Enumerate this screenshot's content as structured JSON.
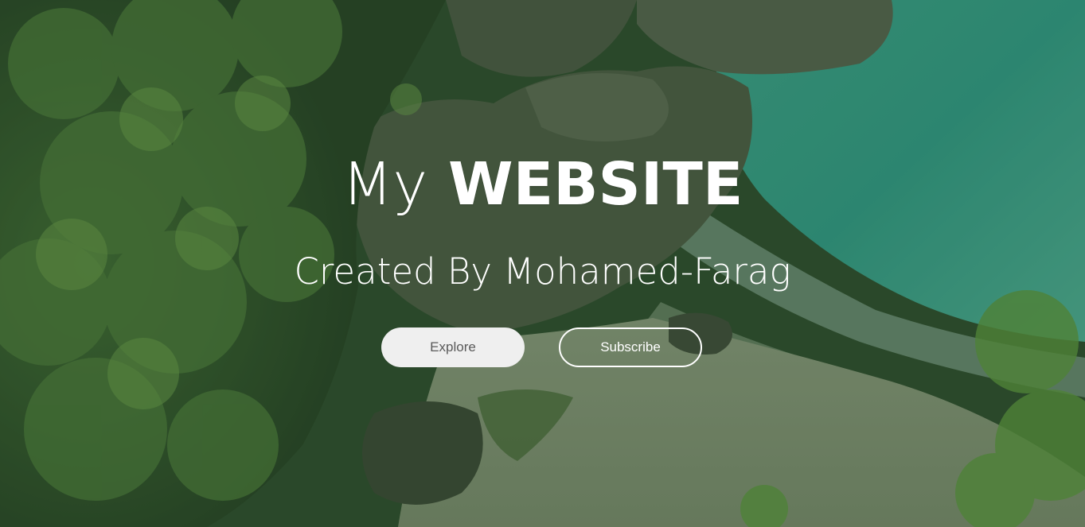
{
  "hero": {
    "title_light": "My",
    "title_bold": "WEBSITE",
    "subtitle": "Created By Mohamed-Farag",
    "buttons": {
      "explore_label": "Explore",
      "subscribe_label": "Subscribe"
    },
    "background_image": "aerial photo of green forest, rocks and turquoise sea beach",
    "colors": {
      "overlay": "#2f4a2c",
      "explore_bg": "#efefef",
      "explore_text": "#5a5a5a",
      "text": "#ffffff"
    }
  }
}
